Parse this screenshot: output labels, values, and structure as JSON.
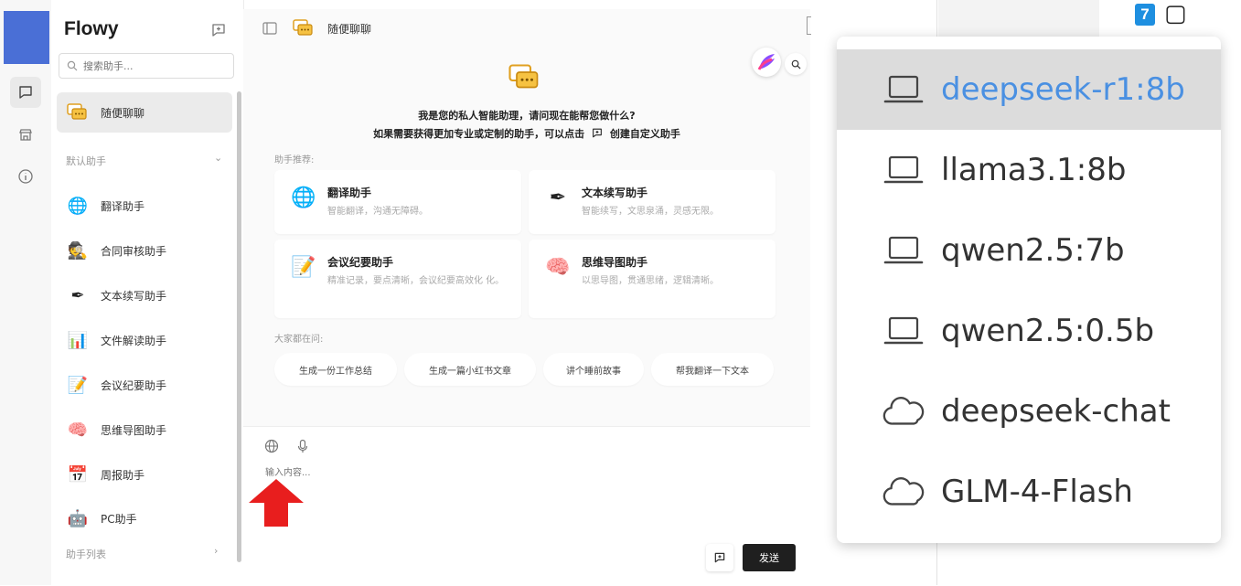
{
  "app": {
    "name": "Flowy"
  },
  "sidebar": {
    "search_placeholder": "搜索助手...",
    "active_item": "随便聊聊",
    "section_default": "默认助手",
    "items": [
      {
        "label": "翻译助手",
        "icon": "globe-icon"
      },
      {
        "label": "合同审核助手",
        "icon": "detective-icon"
      },
      {
        "label": "文本续写助手",
        "icon": "pen-icon"
      },
      {
        "label": "文件解读助手",
        "icon": "chart-icon"
      },
      {
        "label": "会议纪要助手",
        "icon": "memo-icon"
      },
      {
        "label": "思维导图助手",
        "icon": "brain-icon"
      },
      {
        "label": "周报助手",
        "icon": "calendar-icon"
      },
      {
        "label": "PC助手",
        "icon": "robot-icon"
      }
    ],
    "section_list": "助手列表"
  },
  "chat": {
    "title": "随便聊聊",
    "welcome_line1": "我是您的私人智能助理，请问现在能帮您做什么?",
    "welcome_line2_prefix": "如果需要获得更加专业或定制的助手，可以点击",
    "welcome_line2_suffix": "创建自定义助手",
    "recommend_label": "助手推荐:",
    "cards": [
      {
        "title": "翻译助手",
        "desc": "智能翻译，沟通无障碍。",
        "icon": "globe-icon"
      },
      {
        "title": "文本续写助手",
        "desc": "智能续写，文思泉涌，灵感无限。",
        "icon": "pen-icon"
      },
      {
        "title": "会议纪要助手",
        "desc": "精准记录，要点清晰，会议纪要高效化 化。",
        "icon": "memo-icon"
      },
      {
        "title": "思维导图助手",
        "desc": "以思导图，贯通思绪，逻辑清晰。",
        "icon": "brain-icon"
      }
    ],
    "asking_label": "大家都在问:",
    "suggestions": [
      "生成一份工作总结",
      "生成一篇小红书文章",
      "讲个睡前故事",
      "帮我翻译一下文本"
    ],
    "input_placeholder": "输入内容...",
    "send_label": "发送"
  },
  "model_dropdown": {
    "selected": "deepseek-r1:8b",
    "items": [
      {
        "label": "deepseek-r1:8b",
        "kind": "local",
        "icon": "laptop-icon"
      },
      {
        "label": "llama3.1:8b",
        "kind": "local",
        "icon": "laptop-icon"
      },
      {
        "label": "qwen2.5:7b",
        "kind": "local",
        "icon": "laptop-icon"
      },
      {
        "label": "qwen2.5:0.5b",
        "kind": "local",
        "icon": "laptop-icon"
      },
      {
        "label": "deepseek-chat",
        "kind": "cloud",
        "icon": "cloud-icon"
      },
      {
        "label": "GLM-4-Flash",
        "kind": "cloud",
        "icon": "cloud-icon"
      }
    ]
  },
  "background_doc": {
    "step_number": "7"
  },
  "colors": {
    "accent": "#4a90e2",
    "brand": "#4a6fd6",
    "send_button": "#1f1f1f",
    "arrow": "#e81e1e"
  }
}
